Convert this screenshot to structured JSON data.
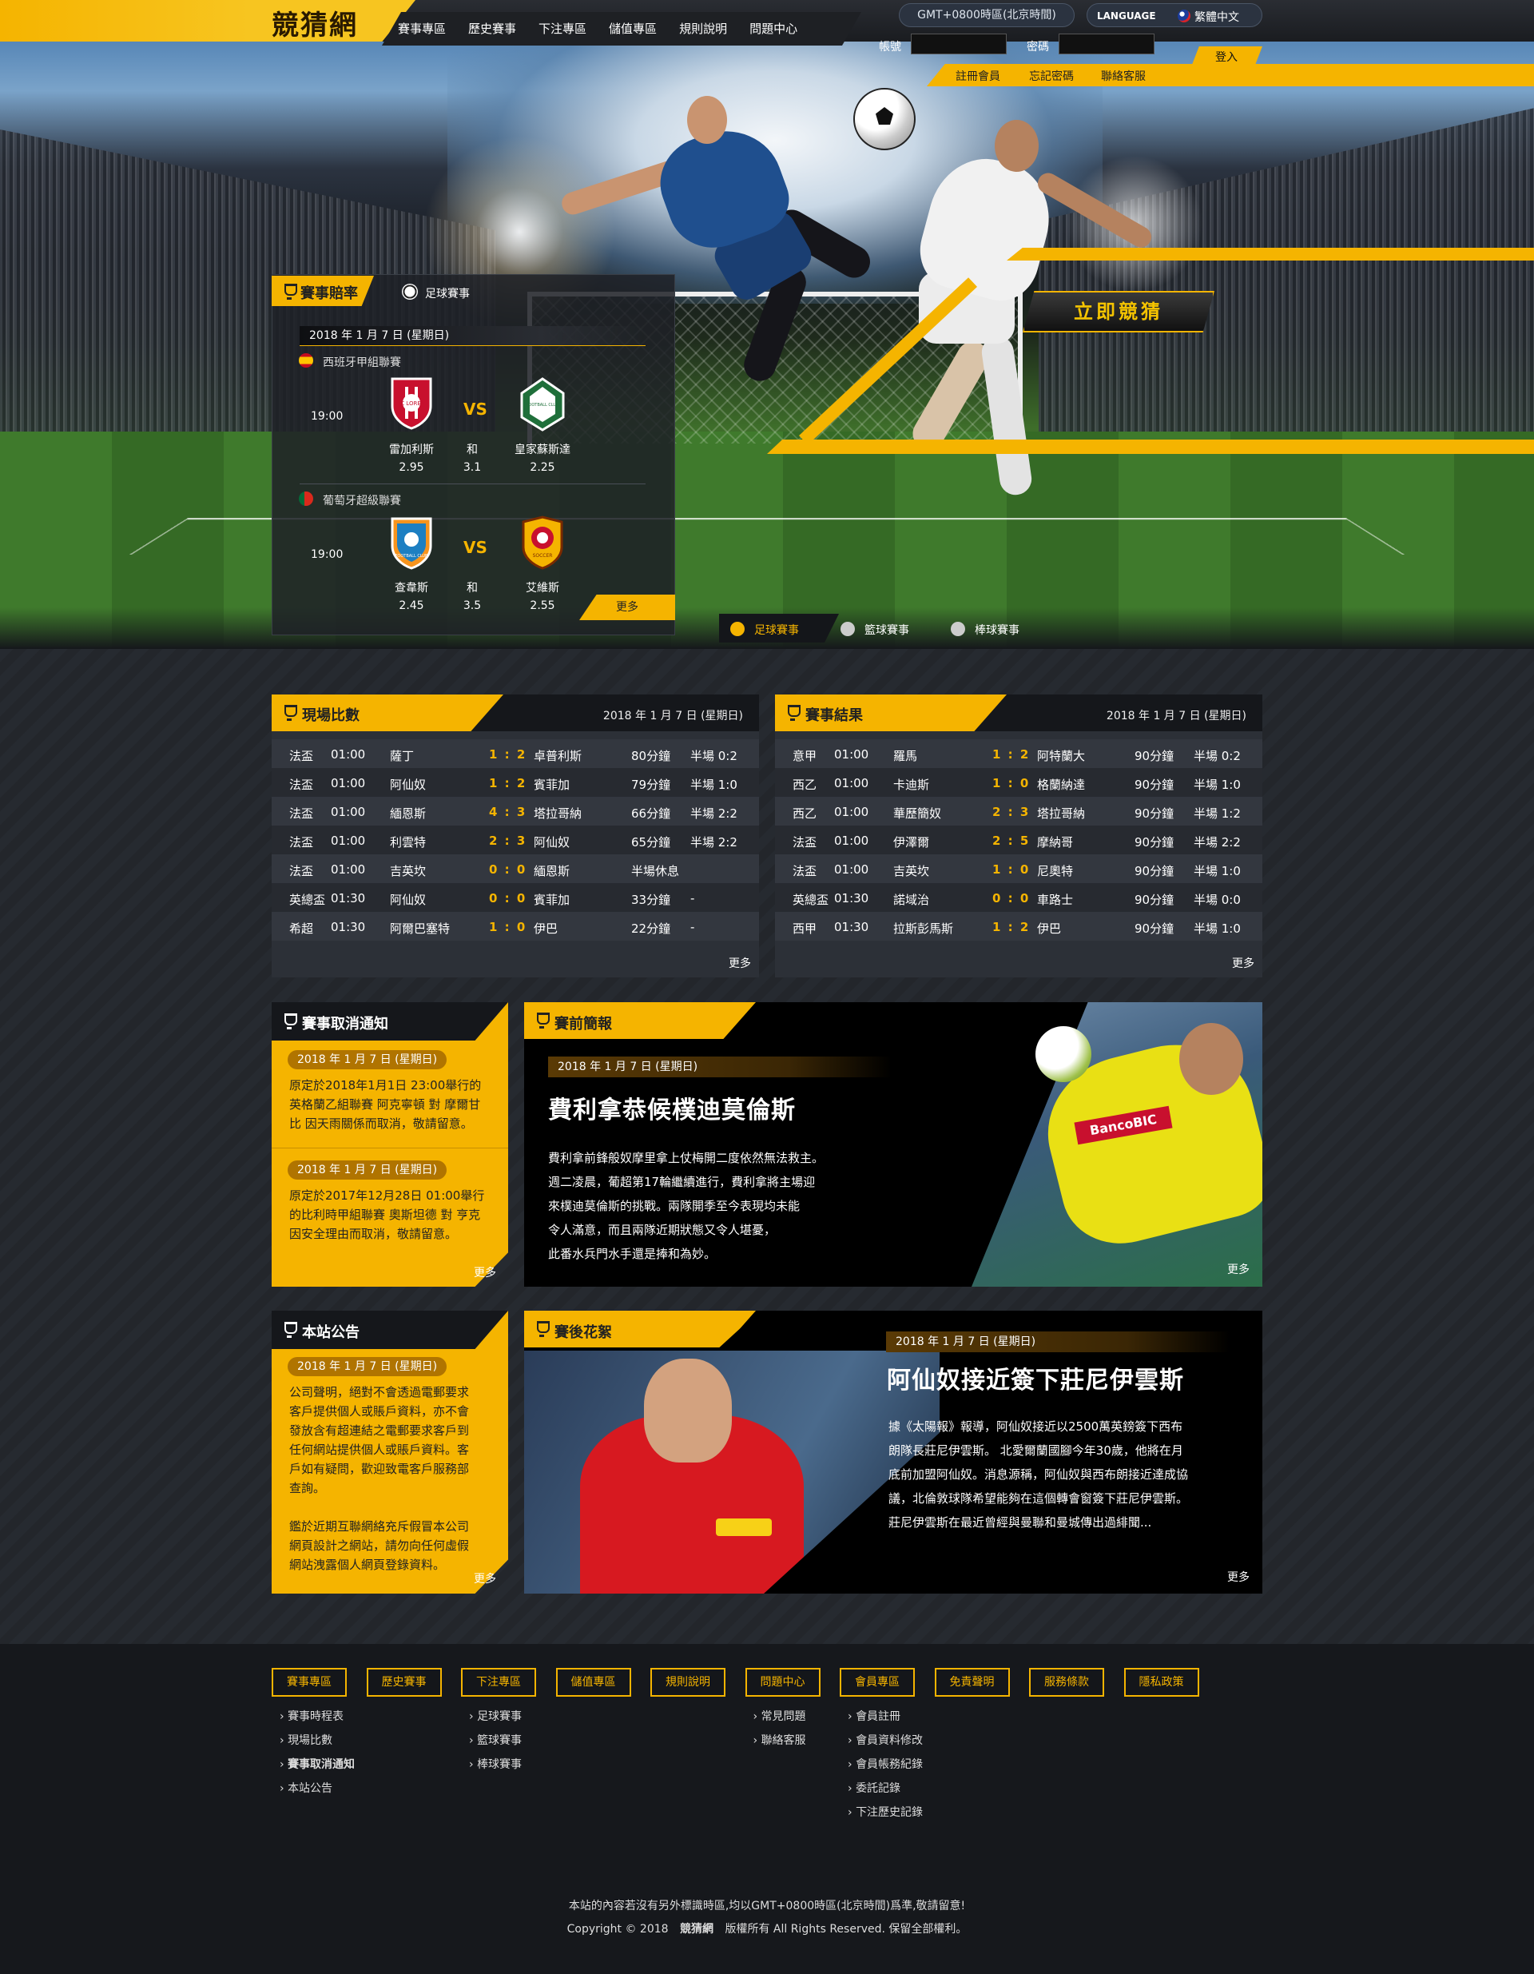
{
  "brand": {
    "logo": "競猜網"
  },
  "nav": {
    "items": [
      "賽事專區",
      "歷史賽事",
      "下注專區",
      "儲值專區",
      "規則說明",
      "問題中心"
    ]
  },
  "topbar": {
    "timezone": "GMT+0800時區(北京時間)",
    "language_label": "LANGUAGE",
    "language_value": "繁體中文",
    "account_label": "帳號",
    "password_label": "密碼",
    "login": "登入",
    "links": [
      "註冊會員",
      "忘記密碼",
      "聯絡客服"
    ]
  },
  "hero": {
    "cta": "立即競猜",
    "sport_tabs": [
      "足球賽事",
      "籃球賽事",
      "棒球賽事"
    ]
  },
  "odds_panel": {
    "title": "賽事賠率",
    "tab": "足球賽事",
    "date": "2018 年 1 月 7 日 (星期日)",
    "more": "更多",
    "matches": [
      {
        "league": "西班牙甲組聯賽",
        "time": "19:00",
        "home": "雷加利斯",
        "draw": "和",
        "away": "皇家蘇斯達",
        "home_odds": "2.95",
        "draw_odds": "3.1",
        "away_odds": "2.25",
        "home_crest": "FC LOREM",
        "away_crest": "FOOTBALL CLUB",
        "vs": "VS"
      },
      {
        "league": "葡萄牙超級聯賽",
        "time": "19:00",
        "home": "查韋斯",
        "draw": "和",
        "away": "艾維斯",
        "home_odds": "2.45",
        "draw_odds": "3.5",
        "away_odds": "2.55",
        "home_crest": "FOOTBALL CLUB",
        "away_crest": "SOCCER",
        "vs": "VS"
      }
    ]
  },
  "live": {
    "title": "現場比數",
    "date": "2018 年 1 月 7 日 (星期日)",
    "more": "更多",
    "rows": [
      [
        "法盃",
        "01:00",
        "薩丁",
        "1 : 2",
        "卓普利斯",
        "80分鐘",
        "半場 0:2"
      ],
      [
        "法盃",
        "01:00",
        "阿仙奴",
        "1 : 2",
        "賓菲加",
        "79分鐘",
        "半場 1:0"
      ],
      [
        "法盃",
        "01:00",
        "緬恩斯",
        "4 : 3",
        "塔拉哥納",
        "66分鐘",
        "半場 2:2"
      ],
      [
        "法盃",
        "01:00",
        "利雲特",
        "2 : 3",
        "阿仙奴",
        "65分鐘",
        "半場 2:2"
      ],
      [
        "法盃",
        "01:00",
        "吉英坎",
        "0 : 0",
        "緬恩斯",
        "半場休息",
        ""
      ],
      [
        "英總盃",
        "01:30",
        "阿仙奴",
        "0 : 0",
        "賓菲加",
        "33分鐘",
        "-"
      ],
      [
        "希超",
        "01:30",
        "阿爾巴塞特",
        "1 : 0",
        "伊巴",
        "22分鐘",
        "-"
      ]
    ]
  },
  "results": {
    "title": "賽事結果",
    "date": "2018 年 1 月 7 日 (星期日)",
    "more": "更多",
    "rows": [
      [
        "意甲",
        "01:00",
        "羅馬",
        "1 : 2",
        "阿特蘭大",
        "90分鐘",
        "半場 0:2"
      ],
      [
        "西乙",
        "01:00",
        "卡迪斯",
        "1 : 0",
        "格蘭納達",
        "90分鐘",
        "半場 1:0"
      ],
      [
        "西乙",
        "01:00",
        "華歷簡奴",
        "2 : 3",
        "塔拉哥納",
        "90分鐘",
        "半場 1:2"
      ],
      [
        "法盃",
        "01:00",
        "伊澤爾",
        "2 : 5",
        "摩納哥",
        "90分鐘",
        "半場 2:2"
      ],
      [
        "法盃",
        "01:00",
        "吉英坎",
        "1 : 0",
        "尼奧特",
        "90分鐘",
        "半場 1:0"
      ],
      [
        "英總盃",
        "01:30",
        "諾域治",
        "0 : 0",
        "車路士",
        "90分鐘",
        "半場 0:0"
      ],
      [
        "西甲",
        "01:30",
        "拉斯彭馬斯",
        "1 : 2",
        "伊巴",
        "90分鐘",
        "半場 1:0"
      ]
    ]
  },
  "cancel": {
    "title": "賽事取消通知",
    "more": "更多",
    "items": [
      {
        "date": "2018 年 1 月 7 日 (星期日)",
        "lines": [
          "原定於2018年1月1日 23:00舉行的",
          "英格蘭乙組聯賽 阿克寧頓 對 摩爾甘",
          "比 因天雨關係而取消，敬請留意。"
        ]
      },
      {
        "date": "2018 年 1 月 7 日 (星期日)",
        "lines": [
          "原定於2017年12月28日 01:00舉行",
          "的比利時甲組聯賽 奧斯坦德 對 亨克",
          "因安全理由而取消，敬請留意。"
        ]
      }
    ]
  },
  "preview": {
    "title": "賽前簡報",
    "date": "2018 年 1 月 7 日 (星期日)",
    "headline": "費利拿恭候樸迪莫倫斯",
    "more": "更多",
    "sponsor": "BancoBIC",
    "lines": [
      "費利拿前鋒般奴摩里拿上仗梅開二度依然無法救主。",
      "週二凌晨，葡超第17輪繼續進行，費利拿將主場迎",
      "來樸迪莫倫斯的挑戰。兩隊開季至今表現均未能",
      "令人滿意，而且兩隊近期狀態又令人堪憂，",
      "此番水兵門水手還是捧和為妙。"
    ]
  },
  "notice": {
    "title": "本站公告",
    "date": "2018 年 1 月 7 日 (星期日)",
    "more": "更多",
    "lines": [
      "公司聲明，絕對不會透過電郵要求",
      "客戶提供個人或賬戶資料，亦不會",
      "發放含有超連結之電郵要求客戶到",
      "任何網站提供個人或賬戶資料。客",
      "戶如有疑問，歡迎致電客戶服務部",
      "查詢。",
      "",
      "鑑於近期互聯網絡充斥假冒本公司",
      "網頁設計之網站，請勿向任何虛假",
      "網站洩露個人網頁登錄資料。"
    ]
  },
  "post": {
    "title": "賽後花絮",
    "date": "2018 年 1 月 7 日 (星期日)",
    "headline": "阿仙奴接近簽下莊尼伊雲斯",
    "more": "更多",
    "lines": [
      "據《太陽報》報導，阿仙奴接近以2500萬英鎊簽下西布",
      "朗隊長莊尼伊雲斯。 北愛爾蘭國腳今年30歲，他將在月",
      "底前加盟阿仙奴。消息源稱，阿仙奴與西布朗接近達成協",
      "議，北倫敦球隊希望能夠在這個轉會窗簽下莊尼伊雲斯。",
      "莊尼伊雲斯在最近曾經與曼聯和曼城傳出過緋聞..."
    ]
  },
  "footer": {
    "heads": [
      "賽事專區",
      "歷史賽事",
      "下注專區",
      "儲值專區",
      "規則說明",
      "問題中心",
      "會員專區",
      "免責聲明",
      "服務條款",
      "隱私政策"
    ],
    "col1": [
      "賽事時程表",
      "現場比數",
      "賽事取消通知",
      "本站公告"
    ],
    "col3": [
      "足球賽事",
      "籃球賽事",
      "棒球賽事"
    ],
    "col6": [
      "常見問題",
      "聯絡客服"
    ],
    "col7": [
      "會員註冊",
      "會員資料修改",
      "會員帳務紀錄",
      "委託記錄",
      "下注歷史記錄"
    ],
    "notice": "本站的內容若沒有另外標識時區,均以GMT+0800時區(北京時間)爲準,敬請留意!",
    "copy_prefix": "Copyright © 2018",
    "copy_brand": "競猜網",
    "copy_suffix": "版權所有  All Rights Reserved. 保留全部權利。"
  },
  "colors": {
    "accent": "#f5b400",
    "dark": "#15171b"
  }
}
